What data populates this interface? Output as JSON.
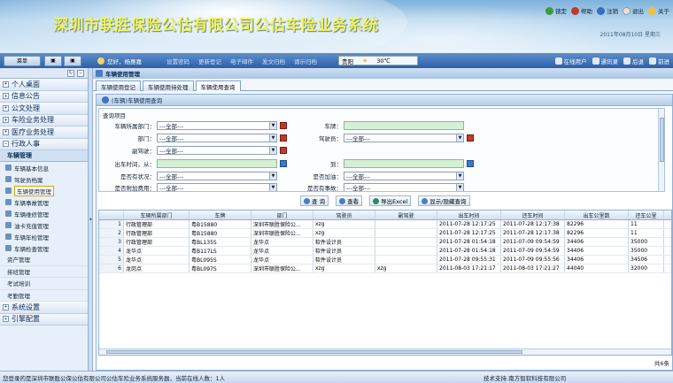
{
  "header": {
    "title": "深圳市联胜保险公估有限公司公估车险业务系统",
    "links": [
      "锁定",
      "帮助",
      "注销",
      "退出",
      "关于"
    ],
    "datetime": "2011年08月10日 星期三"
  },
  "toolbar": {
    "menu_btn": "菜单",
    "welcome": "您好，杨惠嘉",
    "quick_links": [
      "设置密码",
      "更新登记",
      "电子邮件",
      "发文归档",
      "请示归档"
    ],
    "weather_city": "贵阳",
    "weather_temp": "30℃",
    "right_links": [
      "在线用户",
      "通讯录",
      "后退",
      "前进"
    ]
  },
  "sidebar": {
    "items": [
      "个人桌面",
      "信息公告",
      "公文处理",
      "车险业务处理",
      "医疗业务处理",
      "行政人事"
    ],
    "section": "车辆管理",
    "subitems": [
      "车辆基本信息",
      "驾驶员档案",
      "车辆使用管理",
      "车辆事故管理",
      "车辆维修管理",
      "油卡充值管理",
      "车辆年检管理",
      "车辆检查管理"
    ],
    "plain": [
      "资产管理",
      "排班管理",
      "考试培训",
      "考勤管理"
    ],
    "bottom": [
      "系统设置",
      "引擎配置"
    ]
  },
  "main": {
    "title": "车辆使用管理",
    "tabs": [
      "车辆使用登记",
      "车辆使用待处理",
      "车辆使用查询"
    ],
    "panel_title": "(车辆)车辆使用查询",
    "filter_label": "查询项目",
    "fields": {
      "dept_label": "车辆所属部门：",
      "dept_value": "---全部---",
      "plate_label": "车牌：",
      "dept2_label": "部门：",
      "dept2_value": "---全部---",
      "driver_label": "驾驶员：",
      "driver_value": "---全部---",
      "codriver_label": "副驾驶：",
      "codriver_value": "---全部---",
      "out_time_label": "出车时间，从：",
      "to_label": "到：",
      "status_label": "是否有状况：",
      "status_value": "---全部---",
      "fuel_label": "是否加油：",
      "fuel_value": "---全部---",
      "fee_label": "是否附加费用：",
      "fee_value": "---全部---",
      "accident_label": "是否有事故：",
      "accident_value": "---全部---"
    },
    "buttons": [
      "查 询",
      "查看",
      "导出Excel",
      "显示/隐藏查询"
    ],
    "columns": [
      "车辆所属部门",
      "车牌",
      "部门",
      "驾驶员",
      "副驾驶",
      "出车时间",
      "还车时间",
      "出车公里数",
      "还车公里"
    ],
    "rows": [
      [
        "1",
        "行政管理部",
        "粤B15880",
        "深圳市联胜保险公...",
        "xzg",
        "",
        "2011-07-28 12:17:25",
        "2011-07-28 12:17:38",
        "82296",
        "11"
      ],
      [
        "2",
        "行政管理部",
        "粤B15880",
        "深圳市联胜保险公...",
        "xzg",
        "",
        "2011-07-28 12:17:25",
        "2011-07-28 12:17:38",
        "82296",
        "11"
      ],
      [
        "3",
        "行政管理部",
        "粤BL135S",
        "龙华点",
        "软件设计员",
        "",
        "2011-07-28 01:54:18",
        "2011-07-09 09:54:59",
        "34406",
        "35000"
      ],
      [
        "4",
        "龙华点",
        "粤B117LS",
        "龙华点",
        "软件设计员",
        "",
        "2011-07-28 01:54:18",
        "2011-07-09 09:54:59",
        "34406",
        "35000"
      ],
      [
        "5",
        "龙华点",
        "粤BL095S",
        "龙华点",
        "软件设计员",
        "",
        "2011-07-28 09:55:31",
        "2011-07-09 09:55:56",
        "34406",
        "34506"
      ],
      [
        "6",
        "龙岗点",
        "粤BL097S",
        "深圳市联胜保险公...",
        "xzg",
        "xzg",
        "2011-08-03 17:21:17",
        "2011-08-03 17:21:27",
        "44040",
        "32000"
      ]
    ],
    "footer": "共6条"
  },
  "status": {
    "left": "您登录的是深圳市联胜公保公估有限公司公估车险业务系统服务器，当前在线人数：1人",
    "right": "技术支持:南方智软科技有限公司"
  }
}
